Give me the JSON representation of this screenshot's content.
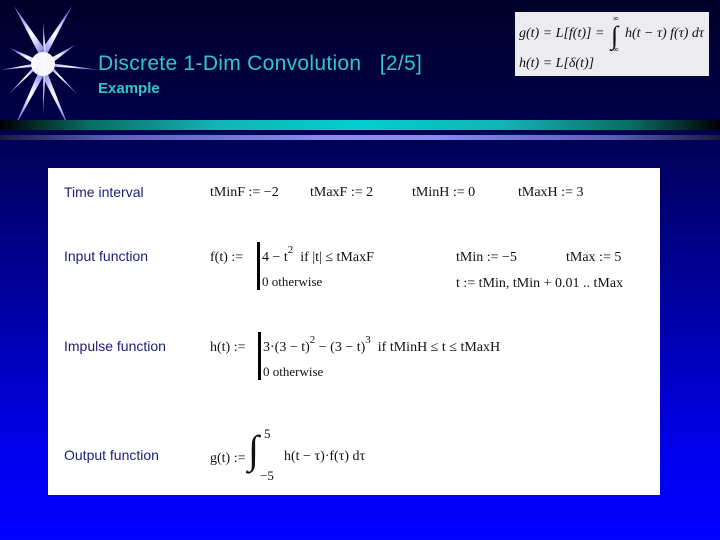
{
  "slide": {
    "title": "Discrete 1-Dim Convolution   [2/5]",
    "subtitle": "Example"
  },
  "formula_box": {
    "line1_lhs": "g(t) = L[f(t)] =",
    "integral_upper": "∞",
    "integral_lower": "∞",
    "line1_rhs": "h(t − τ) f(τ) dτ",
    "line2": "h(t) = L[δ(t)]"
  },
  "panel": {
    "sections": [
      {
        "label": "Time interval"
      },
      {
        "label": "Input function"
      },
      {
        "label": "Impulse function"
      },
      {
        "label": "Output function"
      }
    ],
    "time_interval": {
      "tMinF": "tMinF := −2",
      "tMaxF": "tMaxF := 2",
      "tMinH": "tMinH := 0",
      "tMaxH": "tMaxH := 3"
    },
    "input_function": {
      "lhs": "f(t) :=",
      "case1_pre": "4 − t",
      "case1_exp": "2",
      "case1_cond": "if  |t| ≤ tMaxF",
      "case2": "0   otherwise",
      "tMin": "tMin := −5",
      "tMax": "tMax := 5",
      "range": "t := tMin, tMin + 0.01 .. tMax"
    },
    "impulse_function": {
      "lhs": "h(t) :=",
      "case1_a": "3·(3 − t)",
      "case1_a_exp": "2",
      "case1_b": " − (3 − t)",
      "case1_b_exp": "3",
      "case1_cond": "if  tMinH ≤ t ≤ tMaxH",
      "case2": "0   otherwise"
    },
    "output_function": {
      "lhs": "g(t) :=",
      "upper": "5",
      "lower": "−5",
      "integrand": "h(t − τ)·f(τ) dτ"
    }
  }
}
